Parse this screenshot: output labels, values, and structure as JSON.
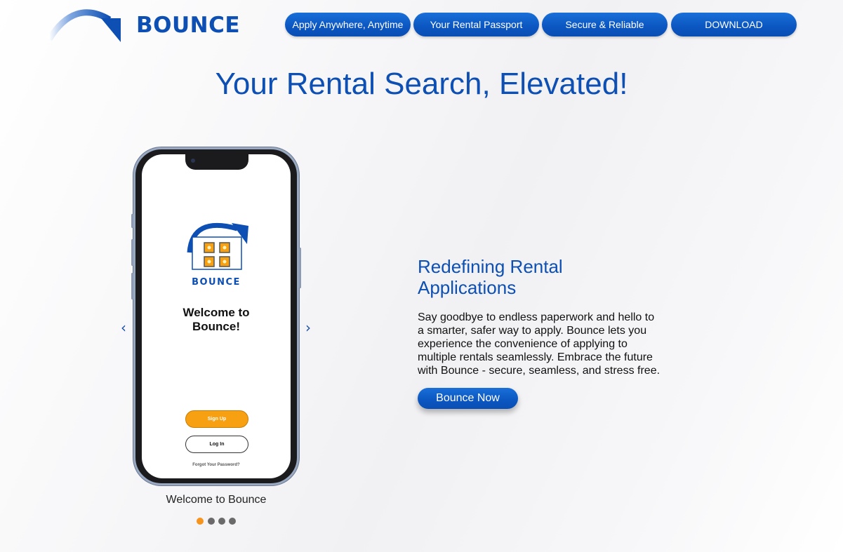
{
  "brand": {
    "name": "BOUNCE",
    "logo_icon": "curved-arrow-icon",
    "primary_color": "#0d4fb3",
    "accent_color": "#f7941d"
  },
  "nav": {
    "items": [
      {
        "label": "Apply Anywhere, Anytime"
      },
      {
        "label": "Your Rental Passport"
      },
      {
        "label": "Secure & Reliable"
      },
      {
        "label": "DOWNLOAD"
      }
    ]
  },
  "hero": {
    "headline": "Your Rental Search, Elevated!"
  },
  "carousel": {
    "prev_icon": "‹",
    "next_icon": "›",
    "caption": "Welcome to Bounce",
    "slide_count": 4,
    "active_index": 0,
    "phone_screen": {
      "logo_text": "BOUNCE",
      "welcome_line1": "Welcome to",
      "welcome_line2": "Bounce!",
      "signup_label": "Sign Up",
      "login_label": "Log In",
      "forgot_label": "Forgot Your Password?"
    }
  },
  "feature": {
    "title": "Redefining Rental Applications",
    "body": "Say goodbye to endless paperwork and hello to a smarter, safer way to apply. Bounce lets you experience the convenience of applying to multiple rentals seamlessly. Embrace the future with Bounce - secure, seamless, and stress free.",
    "cta_label": "Bounce Now"
  }
}
